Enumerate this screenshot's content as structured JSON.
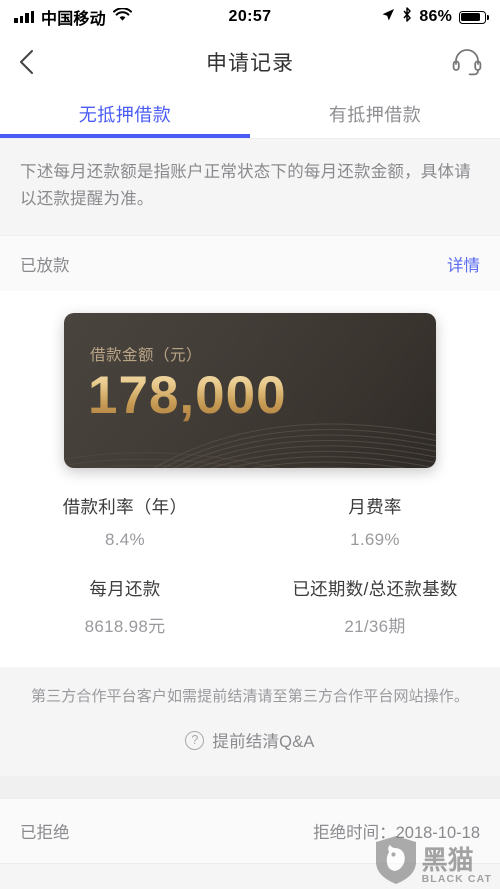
{
  "status_bar": {
    "carrier": "中国移动",
    "time": "20:57",
    "battery_percent": "86%",
    "signal_icon": "signal-bars-icon",
    "wifi_icon": "wifi-icon",
    "location_icon": "location-arrow-icon",
    "bluetooth_icon": "bluetooth-icon",
    "battery_icon": "battery-icon"
  },
  "navbar": {
    "title": "申请记录",
    "back_icon": "back-chevron-icon",
    "support_icon": "headset-icon"
  },
  "tabs": [
    {
      "label": "无抵押借款",
      "active": true
    },
    {
      "label": "有抵押借款",
      "active": false
    }
  ],
  "notice": "下述每月还款额是指账户正常状态下的每月还款金额，具体请以还款提醒为准。",
  "loan": {
    "status": "已放款",
    "details_link": "详情",
    "card": {
      "label": "借款金额（元）",
      "amount": "178,000"
    },
    "metrics": [
      [
        {
          "label": "借款利率（年）",
          "value": "8.4%"
        },
        {
          "label": "月费率",
          "value": "1.69%"
        }
      ],
      [
        {
          "label": "每月还款",
          "value": "8618.98元"
        },
        {
          "label": "已还期数/总还款基数",
          "value": "21/36期"
        }
      ]
    ]
  },
  "third_party": {
    "note": "第三方合作平台客户如需提前结清请至第三方合作平台网站操作。",
    "qa_label": "提前结清Q&A",
    "qa_icon": "question-circle-icon"
  },
  "rejected": {
    "status": "已拒绝",
    "time_text": "拒绝时间：2018-10-18"
  },
  "watermark": {
    "cn": "黑猫",
    "en": "BLACK CAT",
    "logo_icon": "black-cat-shield-icon"
  },
  "colors": {
    "accent_blue": "#4a5cf5",
    "link_blue": "#5b6cf0",
    "gold": "#d8b06a",
    "page_bg": "#f5f5f5"
  }
}
